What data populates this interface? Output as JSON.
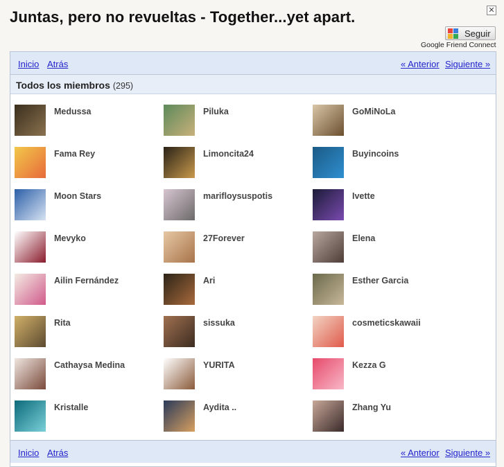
{
  "header": {
    "title": "Juntas, pero no revueltas - Together...yet apart.",
    "close_label": "✕",
    "follow_label": "Seguir",
    "gfc_caption": "Google Friend Connect"
  },
  "nav": {
    "home": "Inicio",
    "back": "Atrás",
    "prev": "« Anterior",
    "next": "Siguiente »"
  },
  "section": {
    "title": "Todos los miembros",
    "count": "(295)"
  },
  "members": [
    {
      "name": "Medussa",
      "colors": [
        "#3a2e1c",
        "#8a7250"
      ]
    },
    {
      "name": "Piluka",
      "colors": [
        "#5c8a5a",
        "#c9b07a"
      ]
    },
    {
      "name": "GoMiNoLa",
      "colors": [
        "#d9c7a8",
        "#6b4f2e"
      ]
    },
    {
      "name": "Fama Rey",
      "colors": [
        "#f2c84b",
        "#e76a3a"
      ]
    },
    {
      "name": "Limoncita24",
      "colors": [
        "#2a2218",
        "#c99a4c"
      ]
    },
    {
      "name": "Buyincoins",
      "colors": [
        "#1b5a86",
        "#2f8fd0"
      ]
    },
    {
      "name": "Moon Stars",
      "colors": [
        "#2c5fa8",
        "#d7e3f2"
      ]
    },
    {
      "name": "marifloysuspotis",
      "colors": [
        "#d7c5d0",
        "#6c6a6a"
      ]
    },
    {
      "name": "Ivette",
      "colors": [
        "#1c1c38",
        "#7a4ab0"
      ]
    },
    {
      "name": "Mevyko",
      "colors": [
        "#ffffff",
        "#8a1c2c"
      ]
    },
    {
      "name": "27Forever",
      "colors": [
        "#e6c8a4",
        "#a8744a"
      ]
    },
    {
      "name": "Elena",
      "colors": [
        "#b8a8a0",
        "#4e3c36"
      ]
    },
    {
      "name": "Ailin Fernández",
      "colors": [
        "#f4ece4",
        "#d05a8a"
      ]
    },
    {
      "name": "Ari",
      "colors": [
        "#2c2418",
        "#a86a3c"
      ]
    },
    {
      "name": "Esther Garcia",
      "colors": [
        "#6a6a4a",
        "#c8b89a"
      ]
    },
    {
      "name": "Rita",
      "colors": [
        "#d0b068",
        "#5c4a30"
      ]
    },
    {
      "name": "sissuka",
      "colors": [
        "#a07050",
        "#3c2c20"
      ]
    },
    {
      "name": "cosmeticskawaii",
      "colors": [
        "#f2d4c4",
        "#e05a4a"
      ]
    },
    {
      "name": "Cathaysa Medina",
      "colors": [
        "#efe6e0",
        "#7a4a3a"
      ]
    },
    {
      "name": "YURITA",
      "colors": [
        "#ffffff",
        "#8a5a3a"
      ]
    },
    {
      "name": "Kezza G",
      "colors": [
        "#e64a6a",
        "#f8b8c8"
      ]
    },
    {
      "name": "Kristalle",
      "colors": [
        "#0c6a7a",
        "#7ad0d8"
      ]
    },
    {
      "name": "Aydita ..",
      "colors": [
        "#2a3a5a",
        "#d8a060"
      ]
    },
    {
      "name": "Zhang Yu",
      "colors": [
        "#c8a898",
        "#3a2a2a"
      ]
    }
  ]
}
